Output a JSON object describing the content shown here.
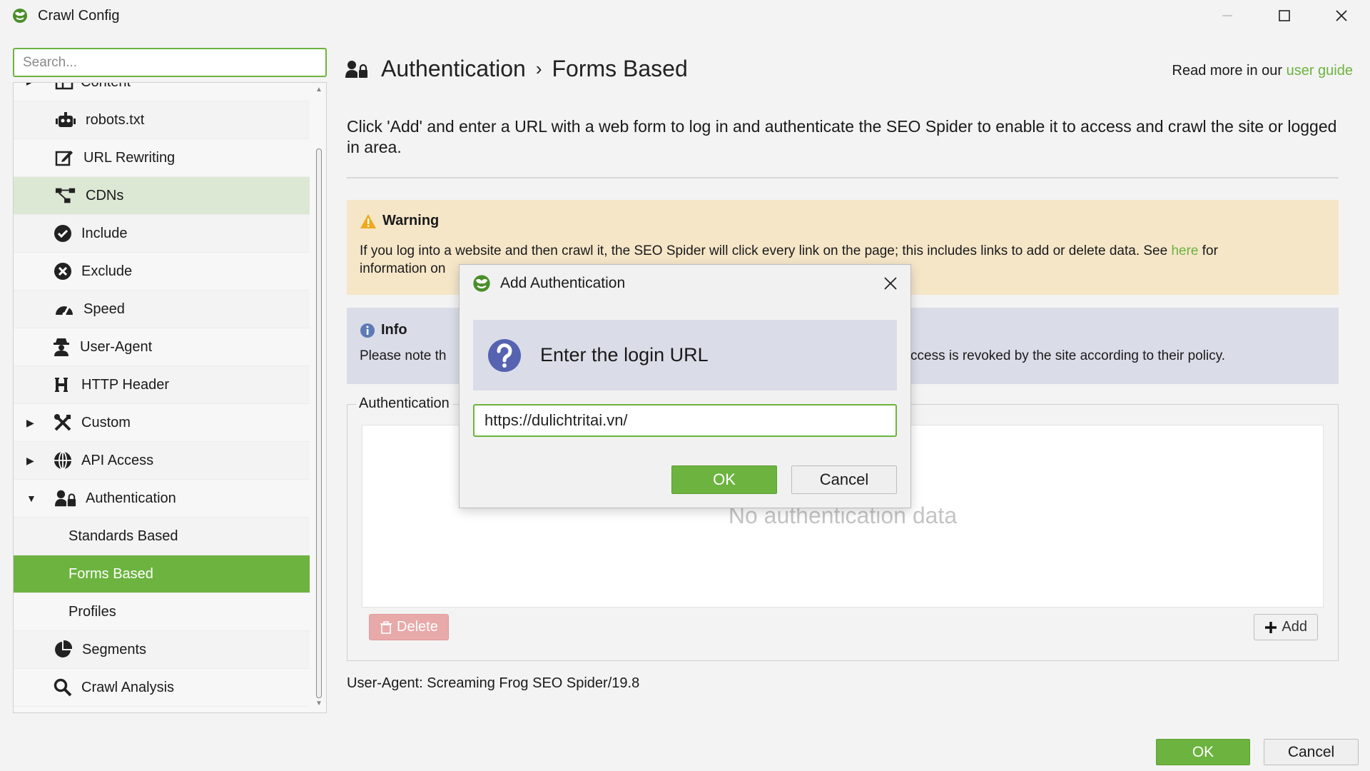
{
  "window": {
    "title": "Crawl Config",
    "app_icon": "frog-globe-icon",
    "controls": {
      "minimize": "minimize-icon",
      "maximize": "maximize-icon",
      "close": "close-icon"
    }
  },
  "sidebar": {
    "search_placeholder": "Search...",
    "items": [
      {
        "label": "Content",
        "icon": "layout-icon",
        "caret": "▸"
      },
      {
        "label": "robots.txt",
        "icon": "robot-icon"
      },
      {
        "label": "URL Rewriting",
        "icon": "edit-icon"
      },
      {
        "label": "CDNs",
        "icon": "network-icon"
      },
      {
        "label": "Include",
        "icon": "check-circle-icon"
      },
      {
        "label": "Exclude",
        "icon": "x-circle-icon"
      },
      {
        "label": "Speed",
        "icon": "gauge-icon"
      },
      {
        "label": "User-Agent",
        "icon": "user-secret-icon"
      },
      {
        "label": "HTTP Header",
        "icon": "h-icon"
      },
      {
        "label": "Custom",
        "icon": "tools-icon",
        "caret": "▶"
      },
      {
        "label": "API Access",
        "icon": "globe-icon",
        "caret": "▶"
      },
      {
        "label": "Authentication",
        "icon": "user-lock-icon",
        "caret": "▼"
      },
      {
        "label": "Standards Based"
      },
      {
        "label": "Forms Based"
      },
      {
        "label": "Profiles"
      },
      {
        "label": "Segments",
        "icon": "pie-chart-icon"
      },
      {
        "label": "Crawl Analysis",
        "icon": "search-icon"
      }
    ]
  },
  "main": {
    "breadcrumb": {
      "section": "Authentication",
      "separator": "›",
      "page": "Forms Based"
    },
    "read_more": {
      "prefix": "Read more in our ",
      "link": "user guide"
    },
    "intro": "Click 'Add' and enter a URL with a web form to log in and authenticate the SEO Spider to enable it to access and crawl the site or logged in area.",
    "warning": {
      "title": "Warning",
      "text_before": "If you log into a website and then crawl it, the SEO Spider will click every link on the page; this includes links to add or delete data. See ",
      "link": "here",
      "text_after": " for",
      "line2": "information on"
    },
    "info": {
      "title": "Info",
      "text_left": "Please note th",
      "text_right": "ccess is revoked by the site according to their policy."
    },
    "auth_group": {
      "legend": "Authentication",
      "empty_text": "No authentication data",
      "delete_label": "Delete",
      "add_label": "Add"
    },
    "user_agent": "User-Agent: Screaming Frog SEO Spider/19.8"
  },
  "footer": {
    "ok_label": "OK",
    "cancel_label": "Cancel"
  },
  "dialog": {
    "title": "Add Authentication",
    "prompt": "Enter the login URL",
    "url_value": "https://dulichtritai.vn/",
    "ok_label": "OK",
    "cancel_label": "Cancel"
  },
  "colors": {
    "accent": "#6cb33f",
    "warning_bg": "#f5e6c8",
    "info_bg": "#dadde8",
    "delete_bg": "#e8a9a9"
  }
}
